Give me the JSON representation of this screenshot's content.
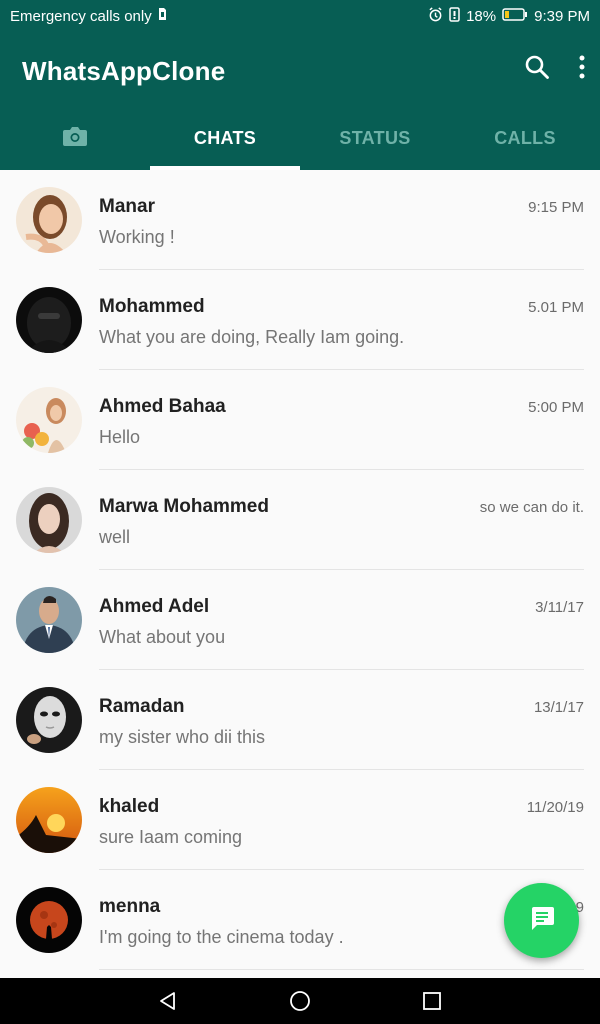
{
  "status_bar": {
    "carrier_text": "Emergency calls only",
    "battery_percent": "18%",
    "time": "9:39 PM",
    "icons": [
      "sim-icon",
      "alarm-icon",
      "data-saver-icon",
      "battery-icon"
    ]
  },
  "app_bar": {
    "title": "WhatsAppClone",
    "icons": [
      "search-icon",
      "more-vert-icon"
    ],
    "color": "#075e54"
  },
  "tabs": [
    {
      "label": "",
      "icon": "camera-icon",
      "active": false
    },
    {
      "label": "CHATS",
      "active": true
    },
    {
      "label": "STATUS",
      "active": false
    },
    {
      "label": "CALLS",
      "active": false
    }
  ],
  "chats": [
    {
      "name": "Manar",
      "message": "Working !",
      "time": "9:15 PM"
    },
    {
      "name": "Mohammed",
      "message": "What you are doing, Really Iam going.",
      "time": "5.01 PM"
    },
    {
      "name": "Ahmed Bahaa",
      "message": "Hello",
      "time": "5:00 PM"
    },
    {
      "name": "Marwa Mohammed",
      "message": "well",
      "time": "so we can do it."
    },
    {
      "name": " Ahmed Adel",
      "message": "What about you",
      "time": "3/11/17"
    },
    {
      "name": "Ramadan",
      "message": "my sister who dii this",
      "time": "13/1/17"
    },
    {
      "name": "khaled",
      "message": "sure Iaam coming",
      "time": "11/20/19"
    },
    {
      "name": " menna",
      "message": "I'm going to the cinema today .",
      "time": "9"
    }
  ],
  "fab": {
    "icon": "message-icon",
    "color": "#25d366"
  },
  "nav_bar": {
    "icons": [
      "back-icon",
      "home-icon",
      "recents-icon"
    ]
  }
}
